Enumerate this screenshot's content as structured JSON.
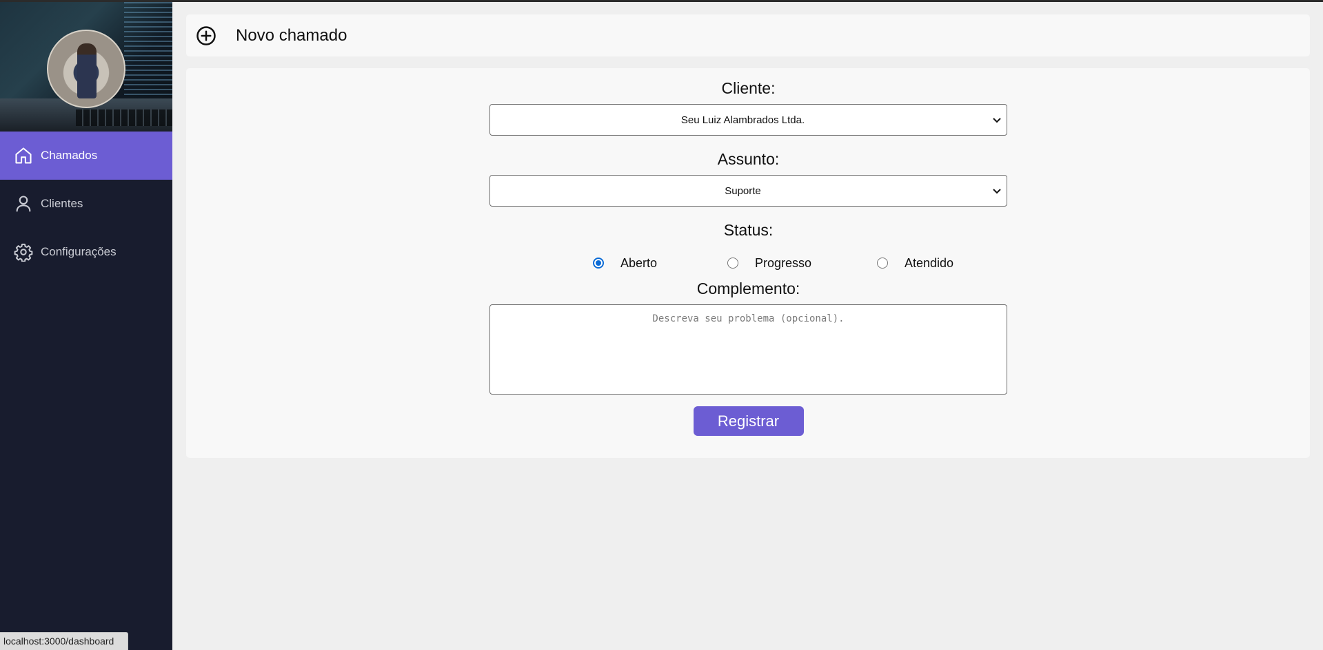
{
  "sidebar": {
    "items": [
      {
        "label": "Chamados",
        "icon": "home-icon",
        "active": true
      },
      {
        "label": "Clientes",
        "icon": "user-icon",
        "active": false
      },
      {
        "label": "Configurações",
        "icon": "gear-icon",
        "active": false
      }
    ]
  },
  "header": {
    "title": "Novo chamado",
    "icon": "plus-circle-icon"
  },
  "form": {
    "cliente_label": "Cliente:",
    "cliente_value": "Seu Luiz Alambrados Ltda.",
    "assunto_label": "Assunto:",
    "assunto_value": "Suporte",
    "status_label": "Status:",
    "status_options": [
      {
        "label": "Aberto",
        "checked": true
      },
      {
        "label": "Progresso",
        "checked": false
      },
      {
        "label": "Atendido",
        "checked": false
      }
    ],
    "complemento_label": "Complemento:",
    "complemento_placeholder": "Descreva seu problema (opcional).",
    "submit_label": "Registrar"
  },
  "statusbar": {
    "url": "localhost:3000/dashboard"
  },
  "colors": {
    "accent": "#6c5dd3",
    "sidebar_bg": "#181c2e",
    "page_bg": "#efefef",
    "radio_checked": "#0b6bd6"
  }
}
